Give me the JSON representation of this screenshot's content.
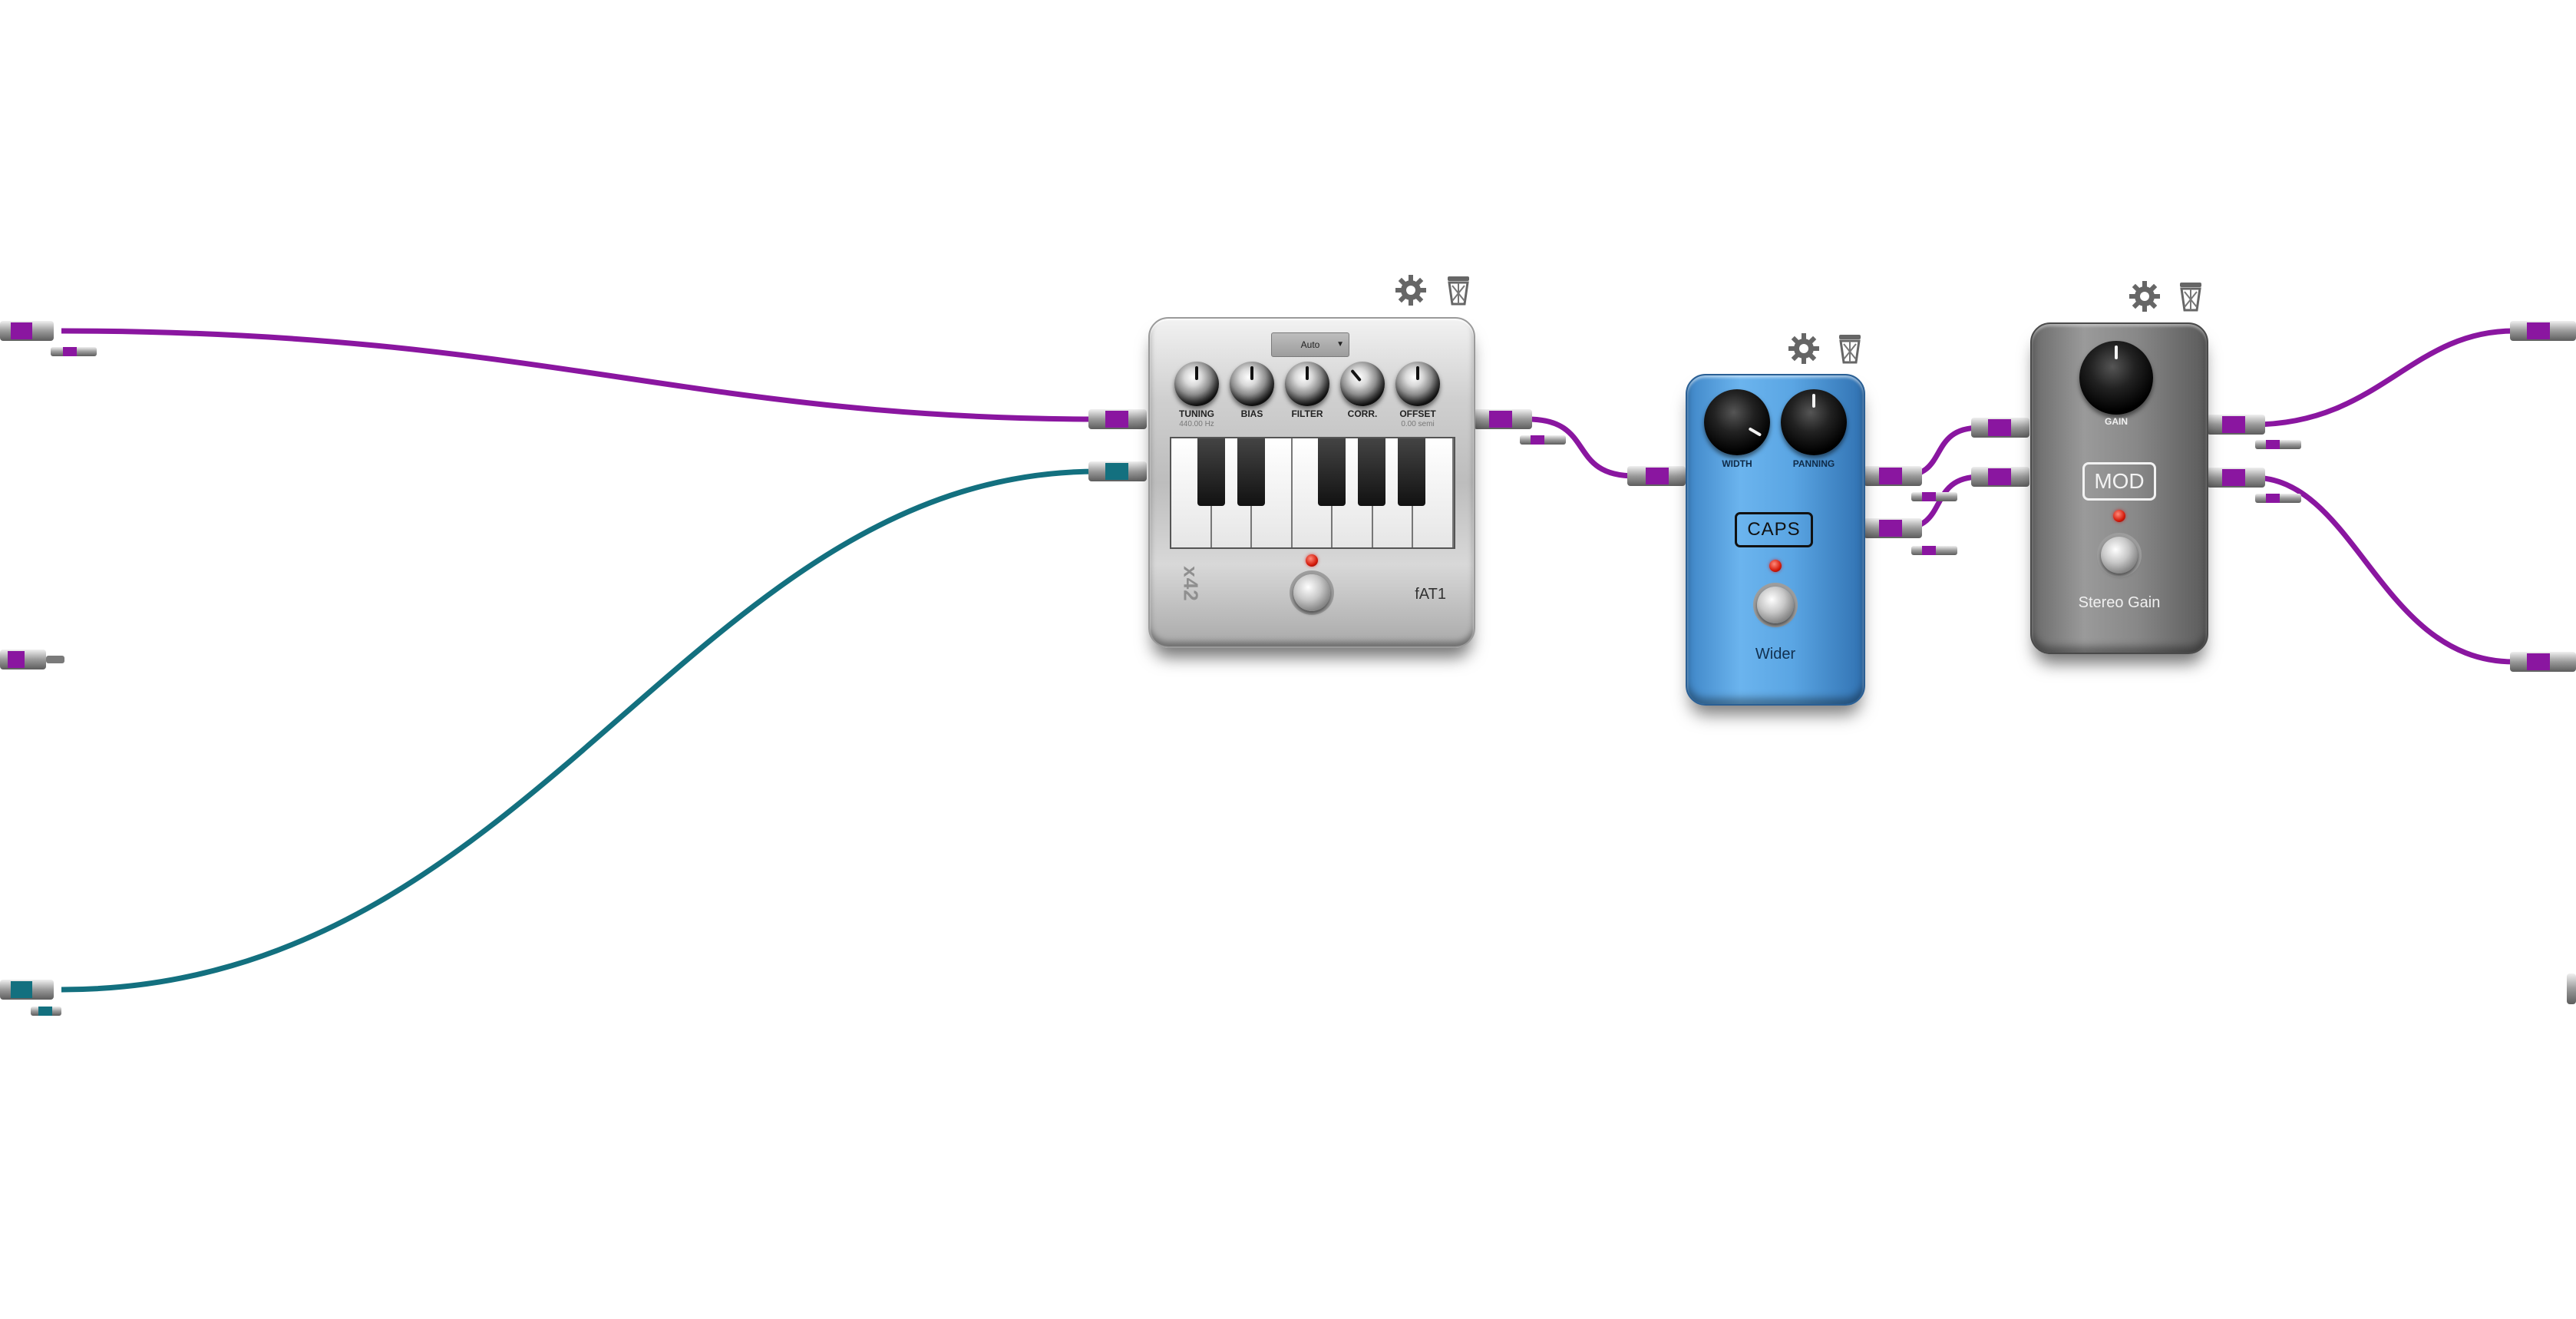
{
  "pedals": {
    "fat1": {
      "brand": "x42",
      "name": "fAT1",
      "mode_select": "Auto",
      "knobs": [
        {
          "label": "TUNING",
          "sub": "440.00 Hz"
        },
        {
          "label": "BIAS",
          "sub": ""
        },
        {
          "label": "FILTER",
          "sub": ""
        },
        {
          "label": "CORR.",
          "sub": ""
        },
        {
          "label": "OFFSET",
          "sub": "0.00 semi"
        }
      ]
    },
    "wider": {
      "brand": "CAPS",
      "name": "Wider",
      "knobs": [
        {
          "label": "WIDTH"
        },
        {
          "label": "PANNING"
        }
      ]
    },
    "stereo_gain": {
      "brand": "MOD",
      "name": "Stereo Gain",
      "knobs": [
        {
          "label": "GAIN"
        }
      ]
    }
  },
  "icons": {
    "settings": "gear-icon",
    "remove": "trash-icon"
  },
  "colors": {
    "audio_cable": "#8a16a0",
    "midi_cable": "#13707f",
    "wider_body": "#5aa5e3",
    "gain_body": "#8a8a8a",
    "fat1_body": "#c8c8c8",
    "led": "#d41a0a"
  }
}
